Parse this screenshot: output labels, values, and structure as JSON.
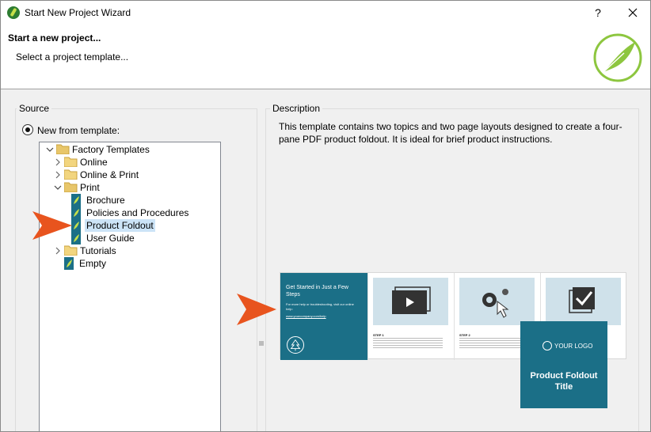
{
  "window": {
    "title": "Start New Project Wizard",
    "help_label": "?"
  },
  "header": {
    "title": "Start a new project...",
    "subtitle": "Select a project template..."
  },
  "source": {
    "group_label": "Source",
    "radio_label": "New from template:",
    "tree": {
      "factory": "Factory Templates",
      "online": "Online",
      "online_print": "Online & Print",
      "print": "Print",
      "brochure": "Brochure",
      "policies": "Policies and Procedures",
      "product_foldout": "Product Foldout",
      "user_guide": "User Guide",
      "tutorials": "Tutorials",
      "empty": "Empty"
    }
  },
  "description": {
    "group_label": "Description",
    "text": "This template contains two topics and two page layouts designed to create a four-pane PDF product foldout.  It is ideal for brief product instructions.",
    "preview": {
      "pane1_title": "Get Started in Just a Few Steps",
      "pane1_small": "For more help or troubleshooting, visit our online help:",
      "pane1_link": "www.yourcompany.com/help",
      "step1": "STEP 1",
      "step2": "STEP 2",
      "logo_text": "YOUR LOGO",
      "card_title": "Product Foldout Title"
    }
  },
  "colors": {
    "accent_teal": "#1b6f87",
    "selection": "#cce4f7",
    "arrow_orange": "#e8541e",
    "logo_green": "#8dc63f"
  }
}
